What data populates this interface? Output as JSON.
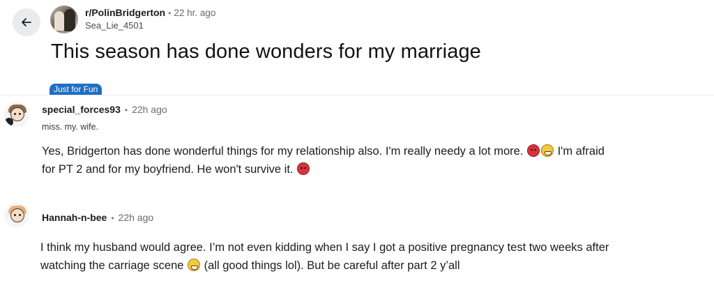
{
  "post": {
    "back_icon": "arrow-left-icon",
    "subreddit": "r/PolinBridgerton",
    "time": "22 hr. ago",
    "username": "Sea_Lie_4501",
    "title": "This season has done wonders for my marriage",
    "flair": "Just for Fun",
    "flair_color": "#1e6fc4"
  },
  "comments": [
    {
      "author": "special_forces93",
      "time": "22h ago",
      "user_flair": "miss. my. wife.",
      "body_line1_a": "Yes, Bridgerton has done wonderful things for my relationship also. I'm really needy a lot more.",
      "body_line1_b": "I'm afraid",
      "body_line2_a": "for PT 2 and for my boyfriend. He won't survive it.",
      "emojis": [
        "angry-face-emoji",
        "grinning-face-emoji",
        "angry-face-emoji"
      ]
    },
    {
      "author": "Hannah-n-bee",
      "time": "22h ago",
      "body_line1": "I think my husband would agree. I’m not even kidding when I say I got a positive pregnancy test two weeks after",
      "body_line2_a": "watching the carriage scene",
      "body_line2_b": "(all good things lol). But be careful after part 2 y’all",
      "emojis": [
        "grinning-face-emoji"
      ]
    }
  ]
}
